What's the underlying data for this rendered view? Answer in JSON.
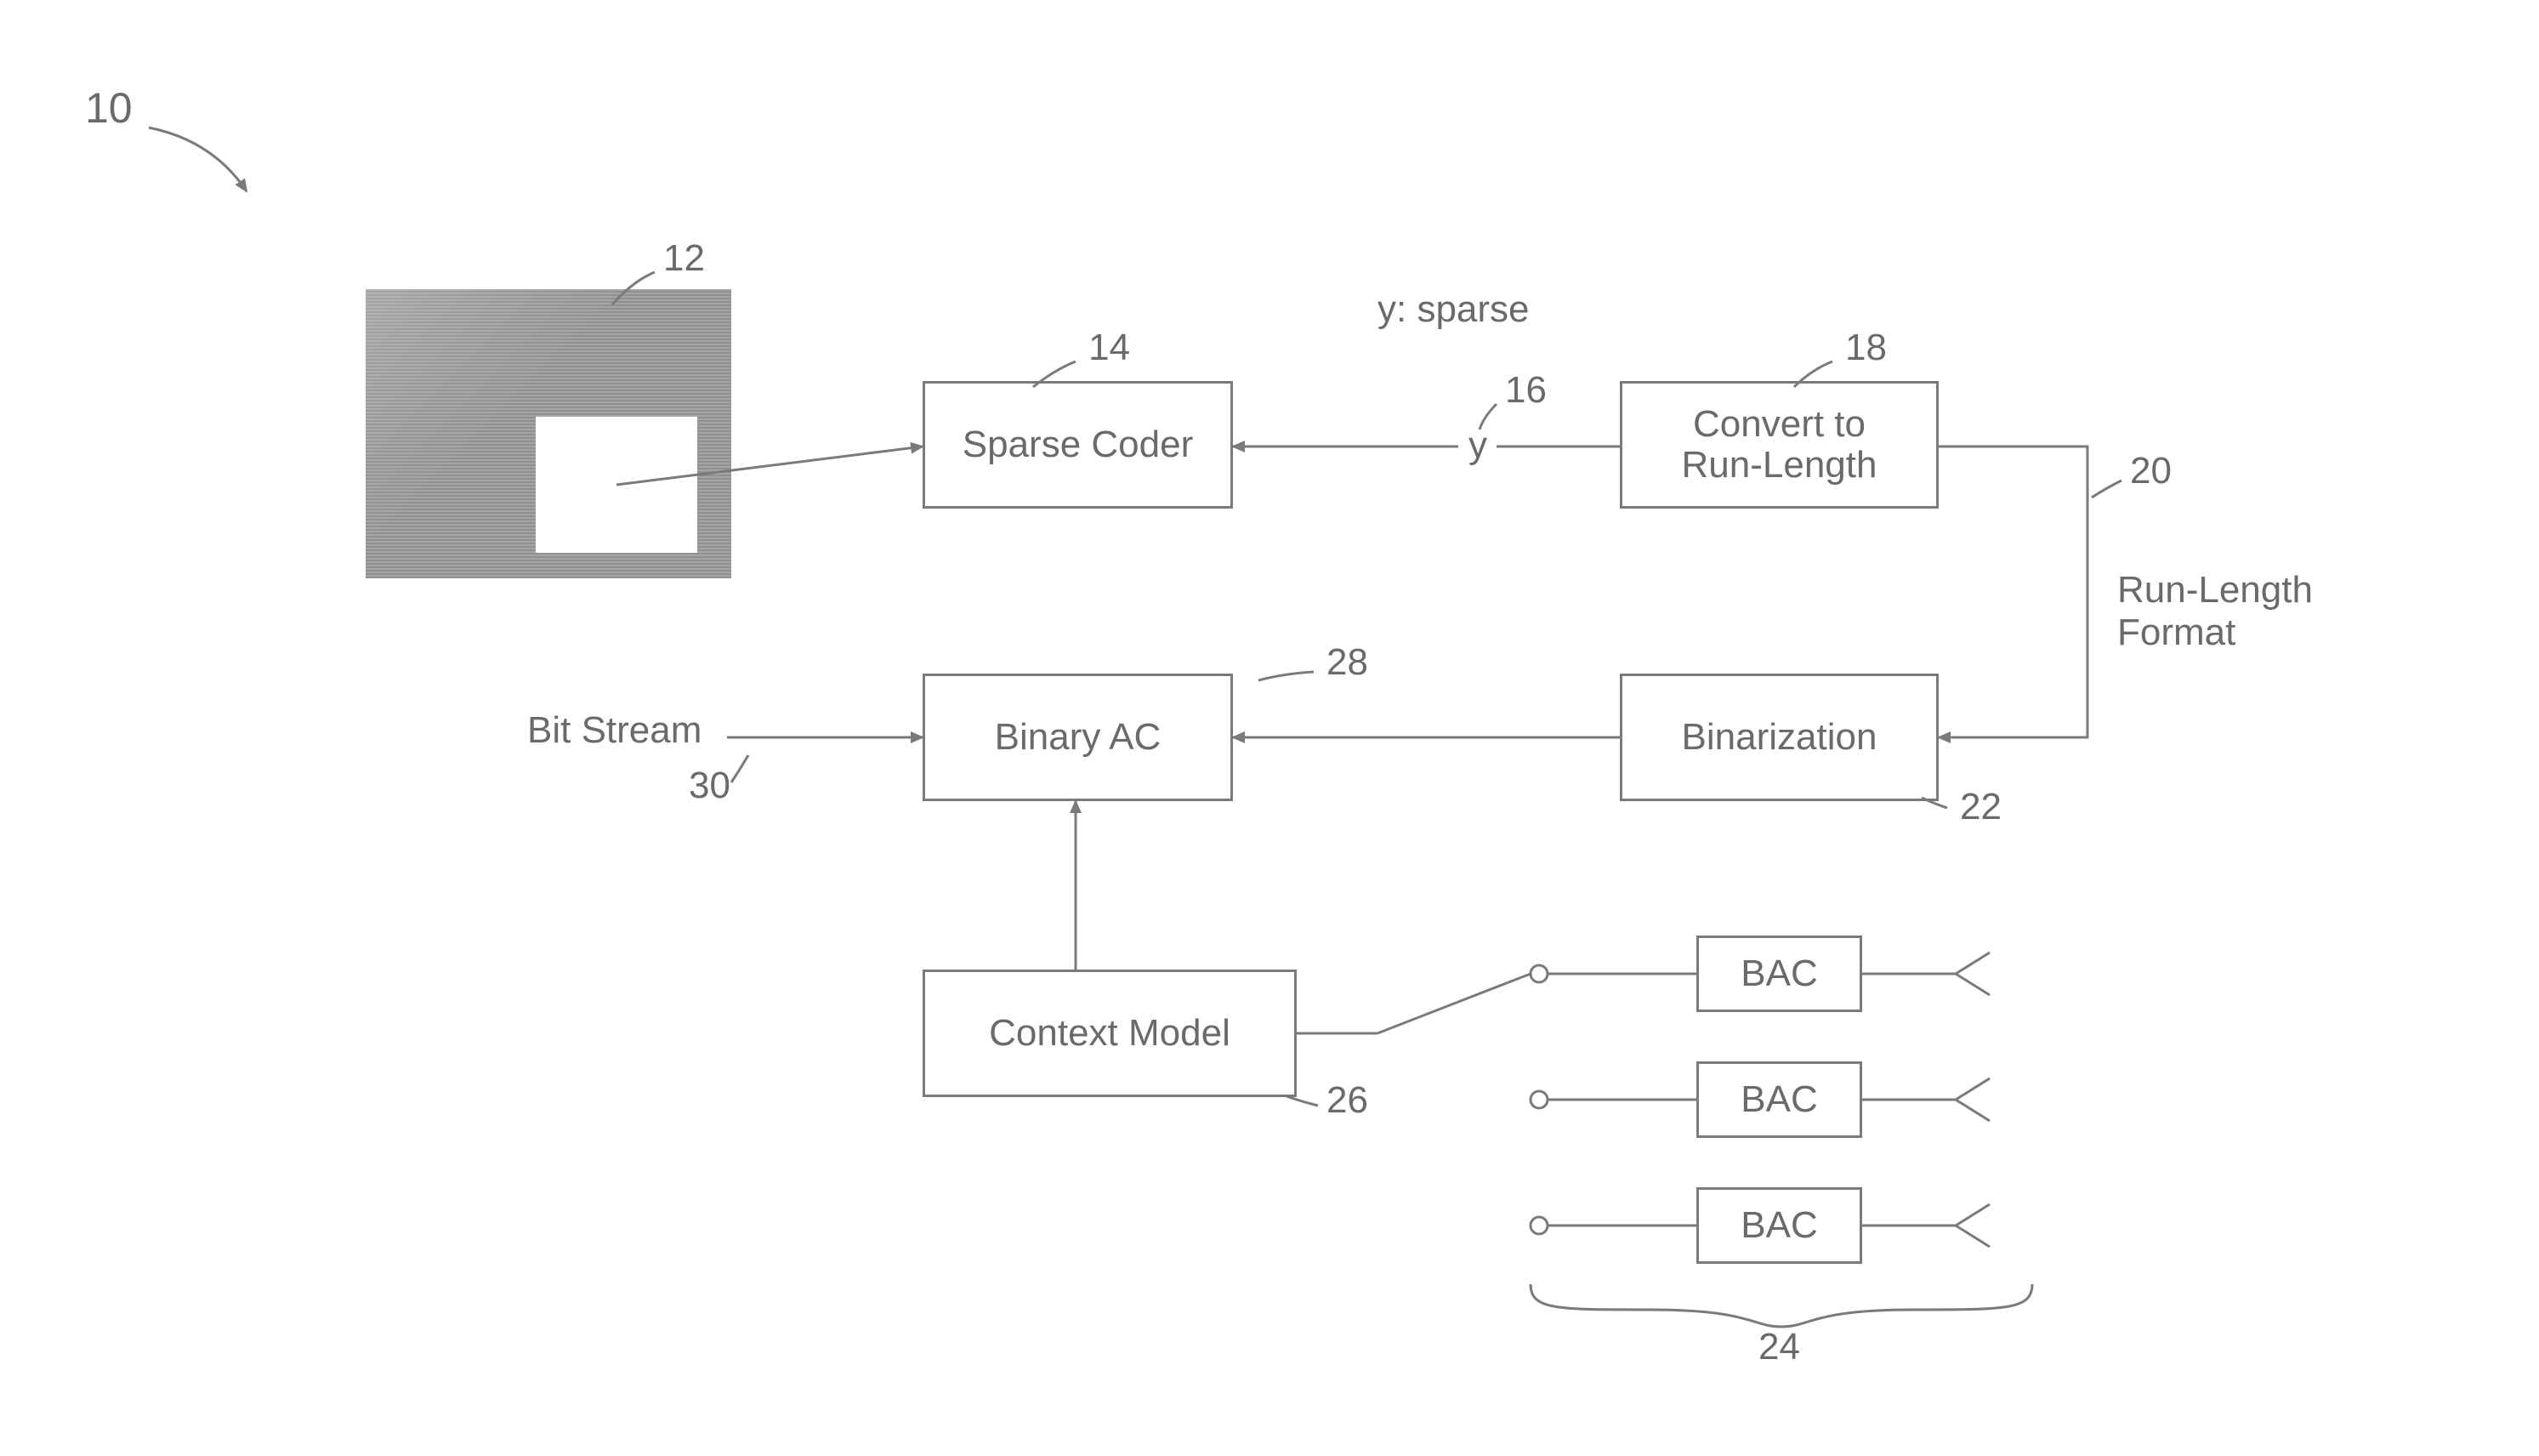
{
  "diagram": {
    "ref_main": "10",
    "image_ref": "12",
    "sparse_coder": {
      "label": "Sparse Coder",
      "ref": "14"
    },
    "y_sparse_title": "y: sparse",
    "y_label": "y",
    "y_ref": "16",
    "convert": {
      "line1": "Convert to",
      "line2": "Run-Length",
      "ref": "18"
    },
    "run_len_path": {
      "line1": "Run-Length",
      "line2": "Format",
      "ref": "20"
    },
    "binarization": {
      "label": "Binarization",
      "ref": "22"
    },
    "binary_ac": {
      "label": "Binary AC",
      "ref": "28"
    },
    "context_model": {
      "label": "Context Model",
      "ref": "26"
    },
    "bit_stream": {
      "label": "Bit Stream",
      "ref": "30"
    },
    "bac": {
      "label1": "BAC",
      "label2": "BAC",
      "label3": "BAC",
      "ref": "24"
    }
  }
}
